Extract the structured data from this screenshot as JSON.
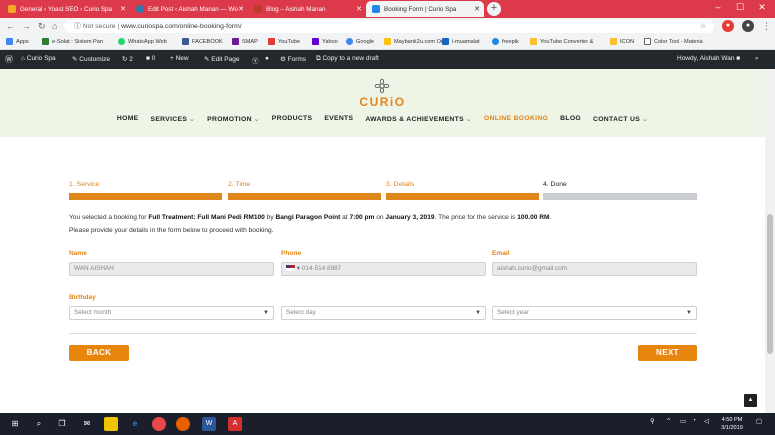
{
  "browser": {
    "tabs": [
      {
        "title": "General ‹ Yoast SEO ‹ Curio Spa",
        "active": false,
        "color": "#f5a623"
      },
      {
        "title": "Edit Post ‹ Aishah Manan — Wo",
        "active": false,
        "color": "#2a7ab0"
      },
      {
        "title": "Blog – Aishah Manan",
        "active": false,
        "color": "#c0392b"
      },
      {
        "title": "Booking Form | Curio Spa",
        "active": true,
        "color": "#1e88e5"
      }
    ],
    "new_tab_icon": "+",
    "window_controls": [
      "–",
      "☐",
      "✕"
    ],
    "url_prefix": "Not secure",
    "url_separator": "|",
    "url": "www.curiospa.com/online-booking-form/",
    "bookmarks": [
      "Apps",
      "e-Solat : Sistem Pan",
      "WhatsApp Web",
      "FACEBOOK",
      "SMAP",
      "YouTube",
      "Yahoo",
      "Google",
      "Maybank2u.com Onl",
      "i-muamalat",
      "freepik",
      "YouTube Converter &",
      "ICON",
      "Color Tool - Materia"
    ]
  },
  "wp_admin_bar": {
    "site_name": "Curio Spa",
    "customize": "Customize",
    "updates_count": "2",
    "comments_count": "0",
    "new": "New",
    "edit_page": "Edit Page",
    "forms": "Forms",
    "copy_draft": "Copy to a new draft",
    "howdy": "Howdy, Aishah Wan"
  },
  "header": {
    "logo": "CURiO",
    "menu": [
      {
        "label": "HOME",
        "dropdown": false,
        "active": false
      },
      {
        "label": "SERVICES",
        "dropdown": true,
        "active": false
      },
      {
        "label": "PROMOTION",
        "dropdown": true,
        "active": false
      },
      {
        "label": "PRODUCTS",
        "dropdown": false,
        "active": false
      },
      {
        "label": "EVENTS",
        "dropdown": false,
        "active": false
      },
      {
        "label": "AWARDS & ACHIEVEMENTS",
        "dropdown": true,
        "active": false
      },
      {
        "label": "ONLINE BOOKING",
        "dropdown": false,
        "active": true
      },
      {
        "label": "BLOG",
        "dropdown": false,
        "active": false
      },
      {
        "label": "CONTACT US",
        "dropdown": true,
        "active": false
      }
    ]
  },
  "steps": [
    {
      "label": "1. Service",
      "state": "done"
    },
    {
      "label": "2. Time",
      "state": "done"
    },
    {
      "label": "3. Details",
      "state": "current"
    },
    {
      "label": "4. Done",
      "state": "pending"
    }
  ],
  "summary": {
    "p1": "You selected a booking for ",
    "service": "Full Treatment: Full Mani Pedi RM100",
    "p2": " by ",
    "staff": "Bangi Paragon Point",
    "p3": " at ",
    "time": "7:00 pm",
    "p4": " on ",
    "date": "January 3, 2019",
    "p5": ". The price for the service is ",
    "price": "100.00 RM",
    "p6": ".",
    "line2": "Please provide your details in the form below to proceed with booking."
  },
  "form": {
    "name_label": "Name",
    "name_value": "WAN AISHAH",
    "phone_label": "Phone",
    "phone_value": "014-514 8987",
    "email_label": "Email",
    "email_value": "aishah.curio@gmail.com",
    "birthday_label": "Birthday",
    "month_placeholder": "Select month",
    "day_placeholder": "Select day",
    "year_placeholder": "Select year"
  },
  "buttons": {
    "back": "BACK",
    "next": "NEXT"
  },
  "taskbar": {
    "time": "4:50 PM",
    "date": "3/1/2019"
  },
  "colors": {
    "accent": "#e8850c",
    "step_done": "#e0861a",
    "step_pending": "#c9cdd1",
    "wp_bar": "#23282d",
    "header_bg": "#eef4e6"
  }
}
